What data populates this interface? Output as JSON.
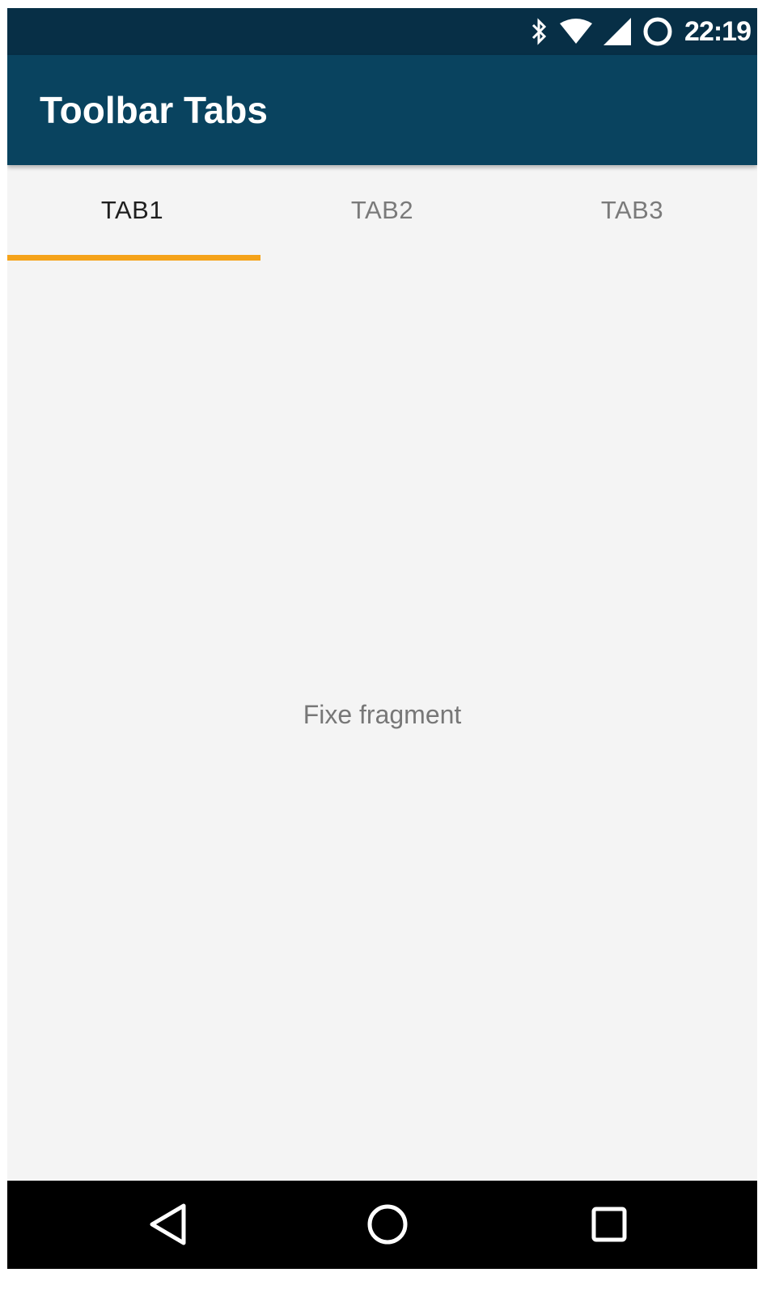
{
  "status_bar": {
    "time": "22:19",
    "icons": [
      "bluetooth-icon",
      "wifi-icon",
      "cell-signal-icon",
      "sync-circle-icon"
    ]
  },
  "toolbar": {
    "title": "Toolbar Tabs"
  },
  "tabs": [
    {
      "label": "TAB1",
      "selected": true
    },
    {
      "label": "TAB2",
      "selected": false
    },
    {
      "label": "TAB3",
      "selected": false
    }
  ],
  "content": {
    "text": "Fixe fragment"
  },
  "nav_bar": {
    "buttons": [
      "back-icon",
      "home-icon",
      "recents-icon"
    ]
  },
  "colors": {
    "status_bar": "#072f46",
    "toolbar": "#09435f",
    "tab_indicator": "#f5a31a",
    "background": "#f4f4f4"
  }
}
